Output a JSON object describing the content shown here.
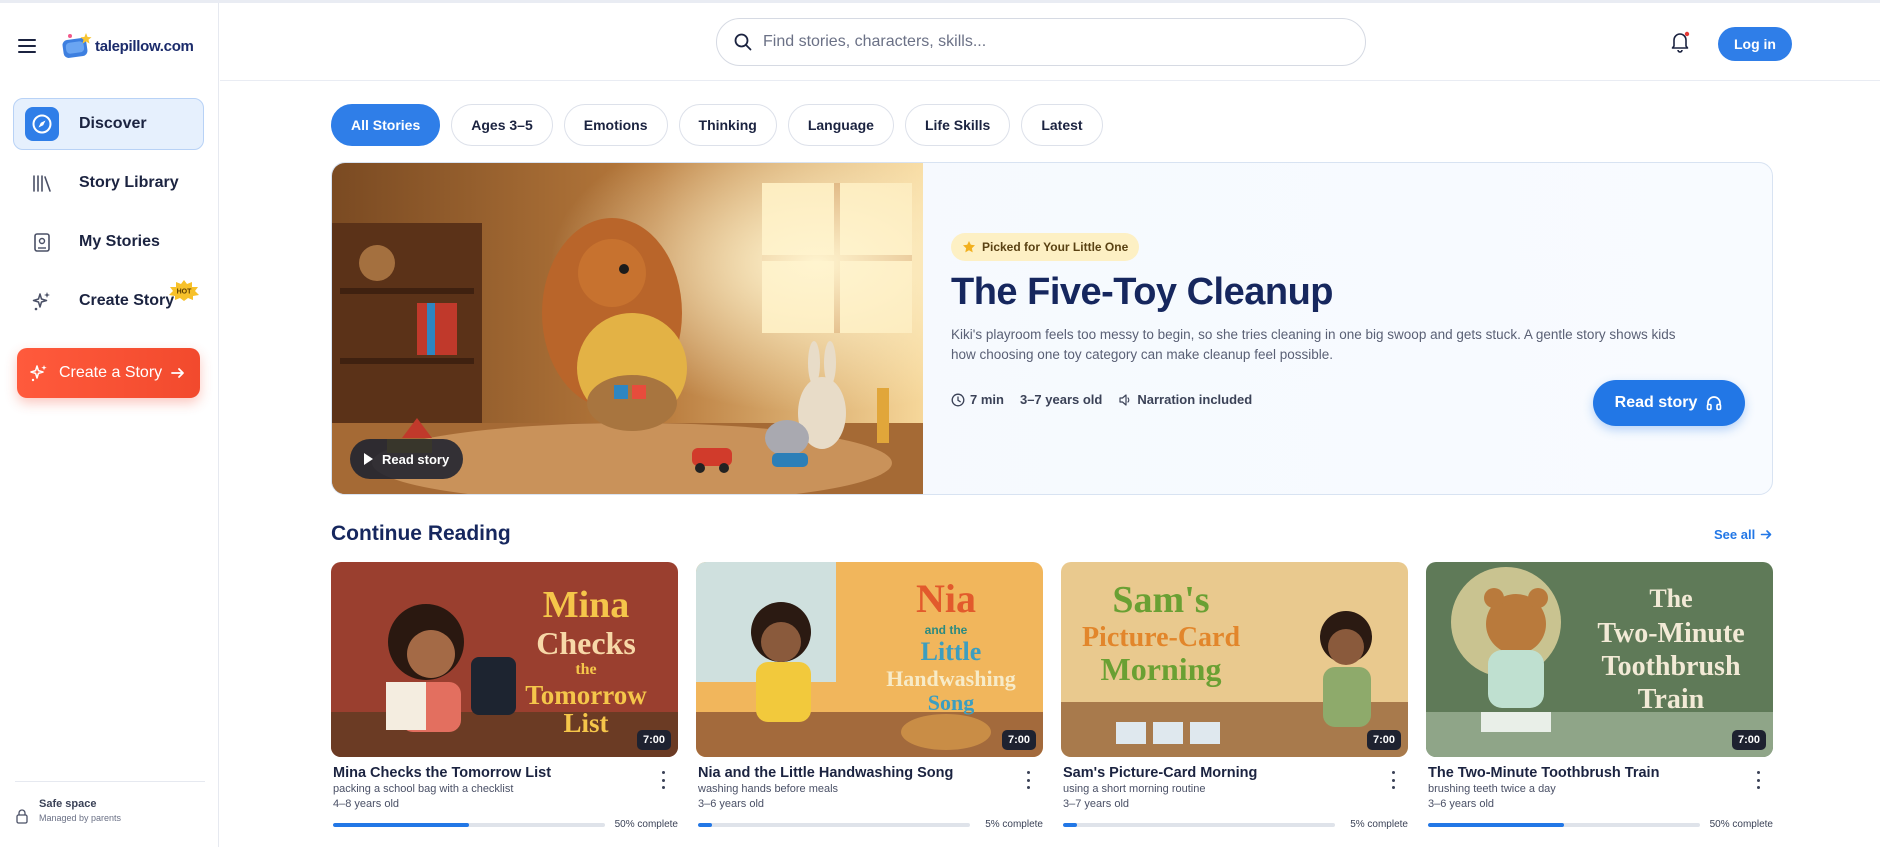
{
  "brand": {
    "name": "talepillow.com"
  },
  "sidebar": {
    "items": [
      {
        "label": "Discover",
        "icon": "compass-icon",
        "active": true
      },
      {
        "label": "Story Library",
        "icon": "library-icon",
        "active": false
      },
      {
        "label": "My Stories",
        "icon": "book-icon",
        "active": false
      },
      {
        "label": "Create Story",
        "icon": "sparkle-icon",
        "active": false,
        "badge": "HOT"
      }
    ],
    "create_button": "Create a Story",
    "safe": {
      "title": "Safe space",
      "subtitle": "Managed by parents"
    }
  },
  "header": {
    "search_placeholder": "Find stories, characters, skills...",
    "login": "Log in"
  },
  "chips": [
    "All Stories",
    "Ages 3–5",
    "Emotions",
    "Thinking",
    "Language",
    "Life Skills",
    "Latest"
  ],
  "hero": {
    "badge": "Picked for Your Little One",
    "title": "The Five-Toy Cleanup",
    "description": "Kiki's playroom feels too messy to begin, so she tries cleaning in one big swoop and gets stuck. A gentle story shows kids how choosing one toy category can make cleanup feel possible.",
    "duration": "7 min",
    "age": "3–7 years old",
    "narration": "Narration included",
    "button": "Read story",
    "image_button": "Read story"
  },
  "continue_reading": {
    "title": "Continue Reading",
    "see_all": "See all",
    "cards": [
      {
        "title": "Mina Checks the Tomorrow List",
        "subtitle": "packing a school bag with a checklist",
        "age": "4–8 years old",
        "duration": "7:00",
        "progress_pct": 50,
        "progress_label": "50% complete"
      },
      {
        "title": "Nia and the Little Handwashing Song",
        "subtitle": "washing hands before meals",
        "age": "3–6 years old",
        "duration": "7:00",
        "progress_pct": 5,
        "progress_label": "5% complete"
      },
      {
        "title": "Sam's Picture-Card Morning",
        "subtitle": "using a short morning routine",
        "age": "3–7 years old",
        "duration": "7:00",
        "progress_pct": 5,
        "progress_label": "5% complete"
      },
      {
        "title": "The Two-Minute Toothbrush Train",
        "subtitle": "brushing teeth twice a day",
        "age": "3–6 years old",
        "duration": "7:00",
        "progress_pct": 50,
        "progress_label": "50% complete"
      }
    ]
  },
  "colors": {
    "accent": "#2f7ee8",
    "cta": "#f24a2d",
    "title": "#16275e",
    "badge_bg": "#fdf0c4"
  }
}
